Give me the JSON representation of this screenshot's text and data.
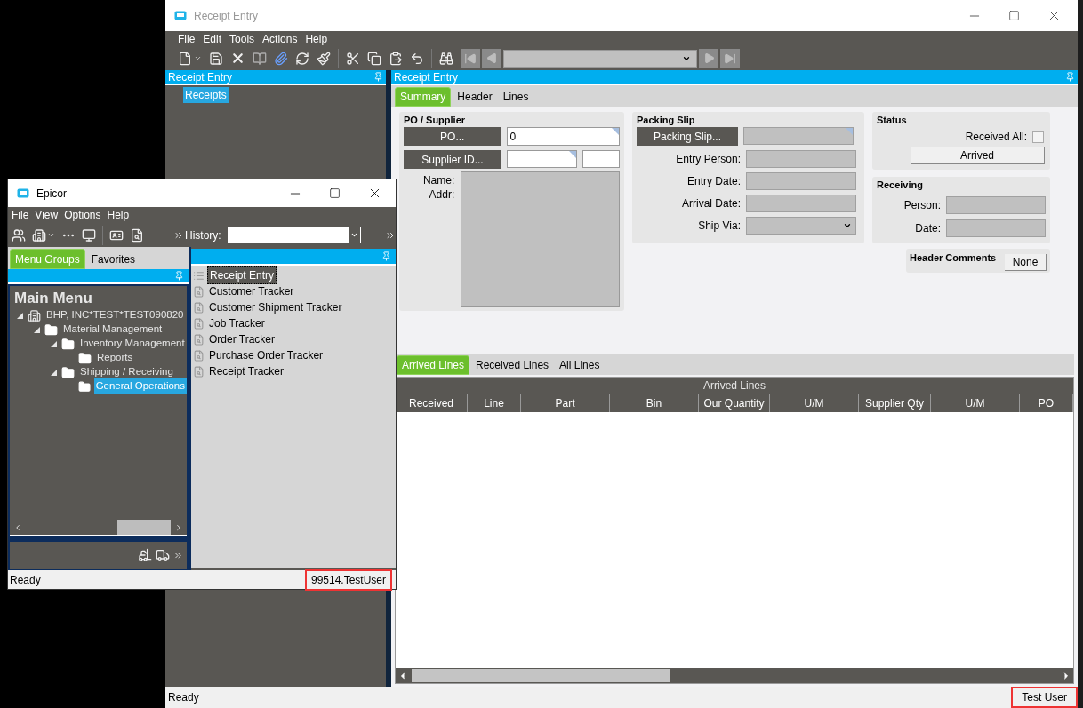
{
  "main_window": {
    "title": "Receipt Entry",
    "menu": [
      "File",
      "Edit",
      "Tools",
      "Actions",
      "Help"
    ],
    "tree_panel": {
      "title": "Receipt Entry",
      "items": [
        {
          "label": "Receipts",
          "selected": true
        }
      ]
    },
    "form_panel": {
      "title": "Receipt Entry",
      "tabs": [
        {
          "label": "Summary",
          "selected": true
        },
        {
          "label": "Header",
          "selected": false
        },
        {
          "label": "Lines",
          "selected": false
        }
      ],
      "po_supplier": {
        "title": "PO / Supplier",
        "po_button": "PO...",
        "po_value": "0",
        "supplier_button": "Supplier ID...",
        "name_label": "Name:",
        "addr_label": "Addr:"
      },
      "packing_slip": {
        "title": "Packing Slip",
        "button": "Packing Slip...",
        "fields": [
          {
            "label": "Entry Person:",
            "kind": "text"
          },
          {
            "label": "Entry Date:",
            "kind": "text"
          },
          {
            "label": "Arrival Date:",
            "kind": "text"
          },
          {
            "label": "Ship Via:",
            "kind": "dropdown"
          }
        ]
      },
      "status": {
        "title": "Status",
        "received_all_label": "Received All:",
        "received_all_checked": false,
        "arrived_button": "Arrived"
      },
      "receiving": {
        "title": "Receiving",
        "fields": [
          {
            "label": "Person:"
          },
          {
            "label": "Date:"
          }
        ]
      },
      "header_comments": {
        "label": "Header Comments",
        "button": "None"
      },
      "line_tabs": [
        {
          "label": "Arrived Lines",
          "selected": true
        },
        {
          "label": "Received Lines",
          "selected": false
        },
        {
          "label": "All Lines",
          "selected": false
        }
      ],
      "grid": {
        "title": "Arrived Lines",
        "columns": [
          "Received",
          "Line",
          "Part",
          "Bin",
          "Our Quantity",
          "U/M",
          "Supplier Qty",
          "U/M",
          "PO"
        ]
      }
    },
    "status_bar": {
      "message": "Ready",
      "user": "Test User"
    }
  },
  "menu_window": {
    "title": "Epicor",
    "menu": [
      "File",
      "View",
      "Options",
      "Help"
    ],
    "history_label": "History:",
    "tabs": [
      {
        "label": "Menu Groups",
        "selected": true
      },
      {
        "label": "Favorites",
        "selected": false
      }
    ],
    "tree": {
      "title": "Main Menu",
      "items": [
        {
          "label": "BHP, INC*TEST*TEST090820",
          "kind": "company",
          "selected": false,
          "children": [
            {
              "label": "Material Management",
              "kind": "folder",
              "selected": false,
              "children": [
                {
                  "label": "Inventory Management",
                  "kind": "folder",
                  "selected": false,
                  "children": [
                    {
                      "label": "Reports",
                      "kind": "folder",
                      "selected": false
                    }
                  ]
                },
                {
                  "label": "Shipping / Receiving",
                  "kind": "folder",
                  "selected": false,
                  "children": [
                    {
                      "label": "General Operations",
                      "kind": "folder",
                      "selected": true
                    }
                  ]
                }
              ]
            }
          ]
        }
      ]
    },
    "programs": [
      {
        "label": "Receipt Entry",
        "kind": "form",
        "selected": true
      },
      {
        "label": "Customer Tracker",
        "kind": "tracker",
        "selected": false
      },
      {
        "label": "Customer Shipment Tracker",
        "kind": "tracker",
        "selected": false
      },
      {
        "label": "Job Tracker",
        "kind": "tracker",
        "selected": false
      },
      {
        "label": "Order Tracker",
        "kind": "tracker",
        "selected": false
      },
      {
        "label": "Purchase Order Tracker",
        "kind": "tracker",
        "selected": false
      },
      {
        "label": "Receipt Tracker",
        "kind": "tracker",
        "selected": false
      }
    ],
    "status_bar": {
      "message": "Ready",
      "user": "99514.TestUser"
    }
  }
}
